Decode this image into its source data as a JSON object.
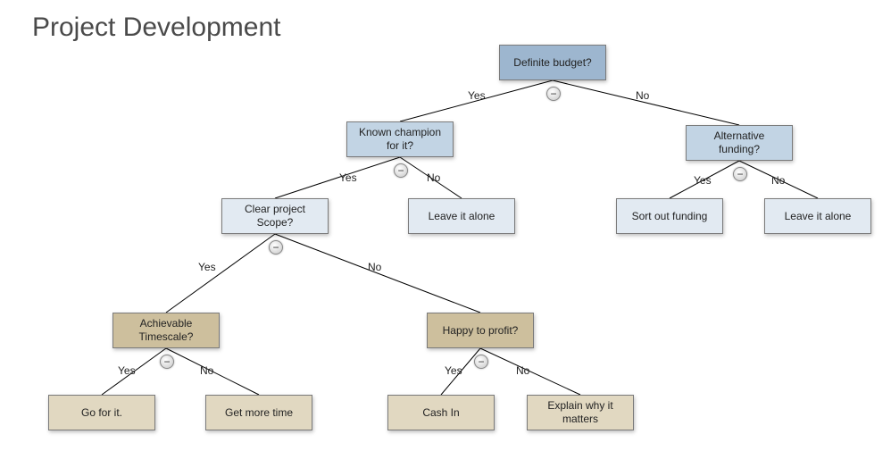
{
  "title": "Project Development",
  "nodes": {
    "root": {
      "label": "Definite budget?"
    },
    "champion": {
      "label": "Known champion for it?"
    },
    "altfund": {
      "label": "Alternative funding?"
    },
    "scope": {
      "label": "Clear project Scope?"
    },
    "leave1": {
      "label": "Leave it alone"
    },
    "sortfund": {
      "label": "Sort out funding"
    },
    "leave2": {
      "label": "Leave it alone"
    },
    "timescale": {
      "label": "Achievable Timescale?"
    },
    "profit": {
      "label": "Happy to profit?"
    },
    "goforit": {
      "label": "Go for it."
    },
    "moretime": {
      "label": "Get more time"
    },
    "cashin": {
      "label": "Cash In"
    },
    "explain": {
      "label": "Explain why it matters"
    }
  },
  "edge_labels": {
    "yes": "Yes",
    "no": "No"
  },
  "collapse_glyph": "−"
}
